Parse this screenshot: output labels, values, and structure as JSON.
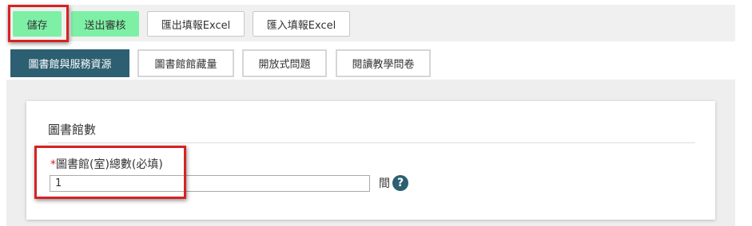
{
  "toolbar": {
    "save_label": "儲存",
    "submit_review_label": "送出審核",
    "export_excel_label": "匯出填報Excel",
    "import_excel_label": "匯入填報Excel"
  },
  "tabs": [
    {
      "label": "圖書館與服務資源",
      "active": true
    },
    {
      "label": "圖書館館藏量",
      "active": false
    },
    {
      "label": "開放式問題",
      "active": false
    },
    {
      "label": "閱讀教學問卷",
      "active": false
    }
  ],
  "section": {
    "title": "圖書館數",
    "field": {
      "required_mark": "*",
      "label": "圖書館(室)總數(必填)",
      "value": "1",
      "unit": "間",
      "help_icon": "question-circle-icon"
    }
  },
  "colors": {
    "green_button": "#7ef0a5",
    "active_tab": "#2c5f72",
    "highlight": "#d62222"
  }
}
